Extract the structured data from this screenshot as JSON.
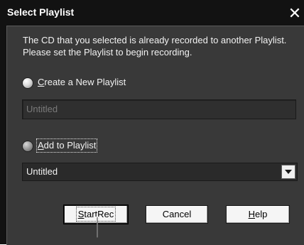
{
  "window": {
    "title": "Select Playlist",
    "close_glyph": "✕"
  },
  "message": "The CD that you selected is already recorded to another Playlist. Please set the Playlist to begin recording.",
  "options": {
    "create_new": {
      "label_accel": "C",
      "label_rest": "reate a New Playlist",
      "selected": false,
      "name_field_value": "Untitled"
    },
    "add_to": {
      "label_accel": "A",
      "label_rest": "dd to Playlist",
      "selected": true,
      "dropdown_value": "Untitled"
    }
  },
  "buttons": {
    "start_rec": {
      "label_accel": "S",
      "label_rest": "tartRec"
    },
    "cancel": {
      "label": "Cancel"
    },
    "help": {
      "label_accel": "H",
      "label_rest": "elp"
    }
  },
  "icons": {
    "close": "close-icon",
    "dropdown": "chevron-down-icon",
    "cursor": "text-cursor-icon"
  },
  "colors": {
    "background": "#393939",
    "titlebar": "#121212",
    "text": "#f2f2f2",
    "disabled_text": "#7a7a7a",
    "button_face": "#f5f5f5"
  }
}
